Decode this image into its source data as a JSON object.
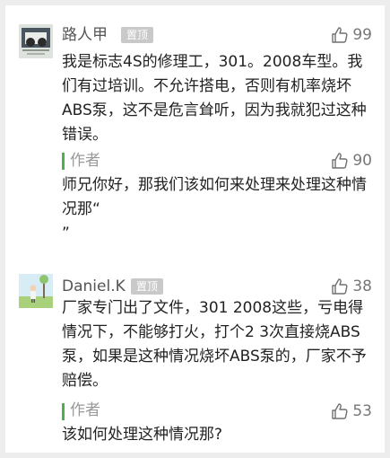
{
  "comments": [
    {
      "username": "路人甲",
      "pin_label": "置顶",
      "likes": "99",
      "body": "我是标志4S的修理工，301。2008车型。我们有过培训。不允许搭电，否则有机率烧坏ABS泵，这不是危言耸听，因为我就犯过这种错误。",
      "reply": {
        "author": "作者",
        "likes": "90",
        "body": "师兄你好，那我们该如何来处理来处理这种情况那“\n”"
      }
    },
    {
      "username": "Daniel.K",
      "pin_label": "置顶",
      "likes": "38",
      "body": "厂家专门出了文件，301 2008这些，亏电得情况下，不能够打火，打个2 3次直接烧ABS泵，如果是这种情况烧坏ABS泵的，厂家不予赔偿。",
      "reply": {
        "author": "作者",
        "likes": "53",
        "body": "该如何处理这种情况那?"
      }
    }
  ],
  "icons": {
    "like": "thumbs-up-outline-icon"
  },
  "colors": {
    "reply_bar": "#4cb04c",
    "pin_badge": "#c9c9c9",
    "body_text": "#222222",
    "meta_text": "#999999"
  }
}
